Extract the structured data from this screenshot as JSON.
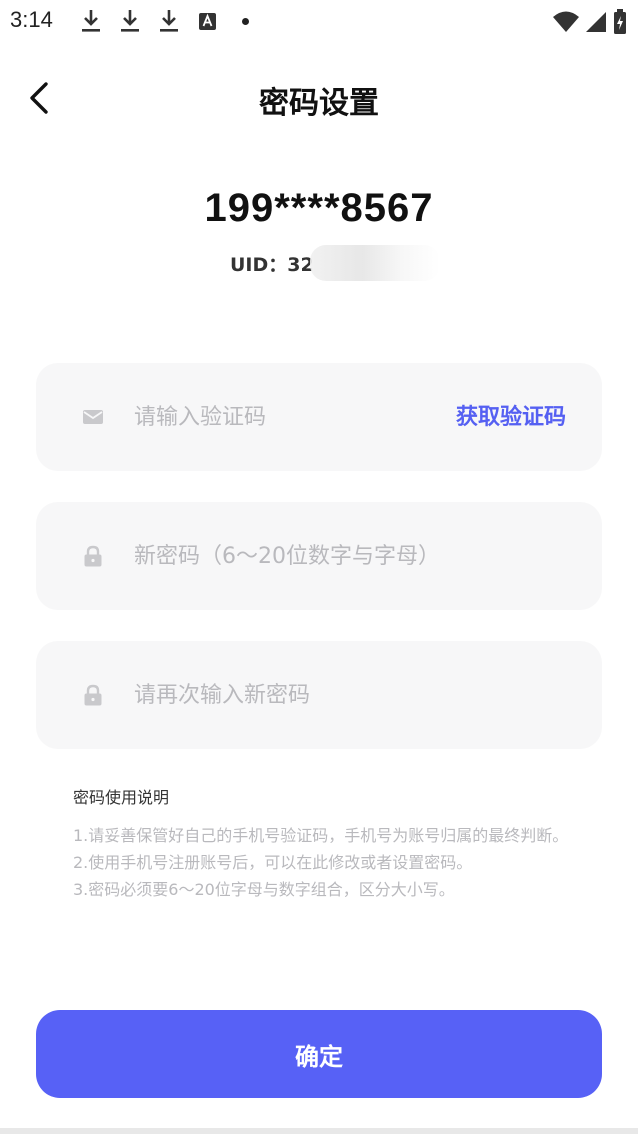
{
  "status_bar": {
    "time": "3:14",
    "icons_left": [
      "download-icon",
      "download-icon",
      "download-icon",
      "font-a-icon",
      "dot-icon"
    ],
    "icons_right": [
      "wifi-icon",
      "signal-icon",
      "battery-charging-icon"
    ]
  },
  "header": {
    "title": "密码设置",
    "back_icon": "chevron-left-icon"
  },
  "account": {
    "phone": "199****8567",
    "uid_label": "UID：32"
  },
  "form": {
    "code_placeholder": "请输入验证码",
    "code_button": "获取验证码",
    "new_password_placeholder": "新密码（6～20位数字与字母）",
    "repeat_password_placeholder": "请再次输入新密码"
  },
  "notes": {
    "title": "密码使用说明",
    "lines": [
      "1.请妥善保管好自己的手机号验证码，手机号为账号归属的最终判断。",
      "2.使用手机号注册账号后，可以在此修改或者设置密码。",
      "3.密码必须要6～20位字母与数字组合，区分大小写。"
    ]
  },
  "confirm_label": "确定",
  "colors": {
    "accent": "#5761f6",
    "link": "#5560f2",
    "field_bg": "#f7f7f8",
    "placeholder": "#b9b9bd"
  }
}
